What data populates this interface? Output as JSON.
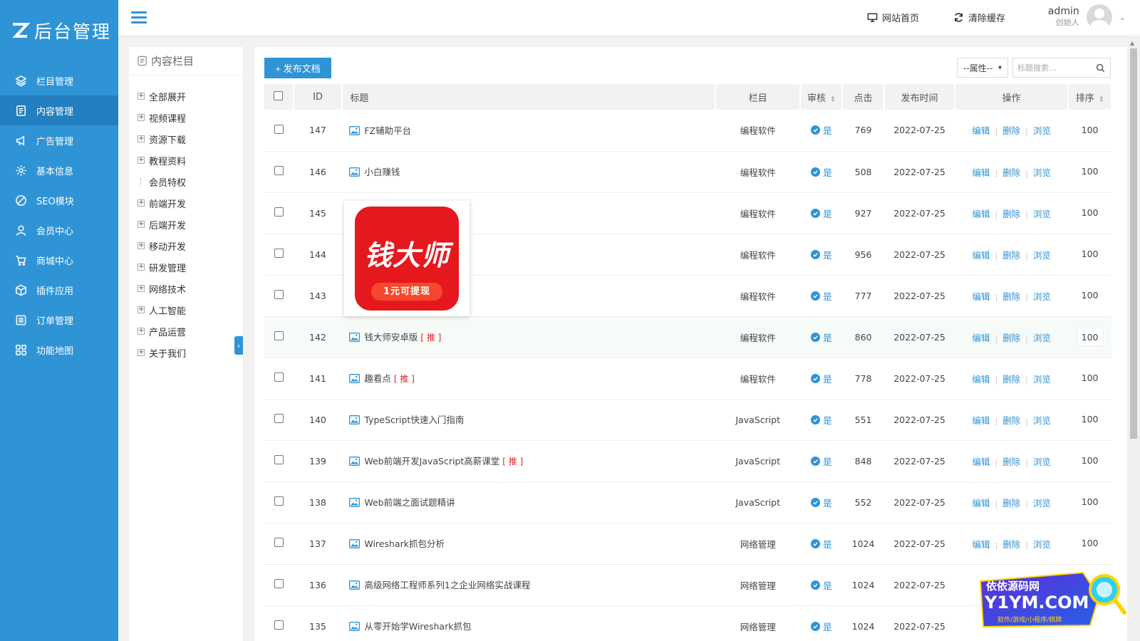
{
  "brand": {
    "logo_text": "后台管理"
  },
  "sidebar": {
    "items": [
      {
        "label": "栏目管理",
        "icon": "layers-icon"
      },
      {
        "label": "内容管理",
        "icon": "document-icon",
        "active": true
      },
      {
        "label": "广告管理",
        "icon": "megaphone-icon"
      },
      {
        "label": "基本信息",
        "icon": "gear-icon"
      },
      {
        "label": "SEO模块",
        "icon": "seo-icon"
      },
      {
        "label": "会员中心",
        "icon": "user-icon"
      },
      {
        "label": "商城中心",
        "icon": "cart-icon"
      },
      {
        "label": "插件应用",
        "icon": "box-icon"
      },
      {
        "label": "订单管理",
        "icon": "list-icon"
      },
      {
        "label": "功能地图",
        "icon": "grid-icon"
      }
    ]
  },
  "header": {
    "site_home": "网站首页",
    "clear_cache": "清除缓存",
    "user_name": "admin",
    "user_role": "创始人"
  },
  "category_panel": {
    "title": "内容栏目",
    "items": [
      {
        "label": "全部展开",
        "expandable": true
      },
      {
        "label": "视频课程",
        "expandable": true
      },
      {
        "label": "资源下载",
        "expandable": true
      },
      {
        "label": "教程资料",
        "expandable": true
      },
      {
        "label": "会员特权",
        "expandable": false
      },
      {
        "label": "前端开发",
        "expandable": true
      },
      {
        "label": "后端开发",
        "expandable": true
      },
      {
        "label": "移动开发",
        "expandable": true
      },
      {
        "label": "研发管理",
        "expandable": true
      },
      {
        "label": "网络技术",
        "expandable": true
      },
      {
        "label": "人工智能",
        "expandable": true
      },
      {
        "label": "产品运营",
        "expandable": true
      },
      {
        "label": "关于我们",
        "expandable": true
      }
    ]
  },
  "toolbar": {
    "publish_label": "+ 发布文档",
    "attr_select": "--属性--",
    "search_placeholder": "标题搜索..."
  },
  "table": {
    "headers": [
      "ID",
      "标题",
      "栏目",
      "审核",
      "点击",
      "发布时间",
      "操作",
      "排序"
    ],
    "audit_yes": "是",
    "op_edit": "编辑",
    "op_delete": "删除",
    "op_view": "浏览",
    "recommend_tag": "[ 推 ]",
    "rows": [
      {
        "id": "147",
        "title": "FZ辅助平台",
        "category": "编程软件",
        "audit": "是",
        "clicks": "769",
        "date": "2022-07-25",
        "sort": "100",
        "rec": false
      },
      {
        "id": "146",
        "title": "小白赚钱",
        "category": "编程软件",
        "audit": "是",
        "clicks": "508",
        "date": "2022-07-25",
        "sort": "100",
        "rec": false
      },
      {
        "id": "145",
        "title": "",
        "category": "编程软件",
        "audit": "是",
        "clicks": "927",
        "date": "2022-07-25",
        "sort": "100",
        "rec": false
      },
      {
        "id": "144",
        "title": "",
        "category": "编程软件",
        "audit": "是",
        "clicks": "956",
        "date": "2022-07-25",
        "sort": "100",
        "rec": false
      },
      {
        "id": "143",
        "title": "",
        "category": "编程软件",
        "audit": "是",
        "clicks": "777",
        "date": "2022-07-25",
        "sort": "100",
        "rec": false
      },
      {
        "id": "142",
        "title": "钱大师安卓版",
        "category": "编程软件",
        "audit": "是",
        "clicks": "860",
        "date": "2022-07-25",
        "sort": "100",
        "rec": true,
        "highlight": true
      },
      {
        "id": "141",
        "title": "趣看点",
        "category": "编程软件",
        "audit": "是",
        "clicks": "778",
        "date": "2022-07-25",
        "sort": "100",
        "rec": true
      },
      {
        "id": "140",
        "title": "TypeScript快速入门指南",
        "category": "JavaScript",
        "audit": "是",
        "clicks": "551",
        "date": "2022-07-25",
        "sort": "100",
        "rec": false
      },
      {
        "id": "139",
        "title": "Web前端开发JavaScript高薪课堂",
        "category": "JavaScript",
        "audit": "是",
        "clicks": "848",
        "date": "2022-07-25",
        "sort": "100",
        "rec": true
      },
      {
        "id": "138",
        "title": "Web前端之面试题精讲",
        "category": "JavaScript",
        "audit": "是",
        "clicks": "552",
        "date": "2022-07-25",
        "sort": "100",
        "rec": false
      },
      {
        "id": "137",
        "title": "Wireshark抓包分析",
        "category": "网络管理",
        "audit": "是",
        "clicks": "1024",
        "date": "2022-07-25",
        "sort": "100",
        "rec": false
      },
      {
        "id": "136",
        "title": "高级网络工程师系列1之企业网络实战课程",
        "category": "网络管理",
        "audit": "是",
        "clicks": "1024",
        "date": "2022-07-25",
        "sort": "",
        "rec": false
      },
      {
        "id": "135",
        "title": "从零开始学Wireshark抓包",
        "category": "网络管理",
        "audit": "是",
        "clicks": "1024",
        "date": "2022-07-25",
        "sort": "",
        "rec": false
      }
    ]
  },
  "preview": {
    "app_name": "钱大师",
    "app_tagline": "1元可提现"
  },
  "watermark": {
    "line1": "依依源码网",
    "line2": "Y1YM.COM",
    "line3": "软件/游戏/小程序/棋牌"
  },
  "colors": {
    "accent": "#2f94d6",
    "sidebar_active": "#237fbf",
    "recommend": "#e02020",
    "app_red": "#e5181e"
  }
}
